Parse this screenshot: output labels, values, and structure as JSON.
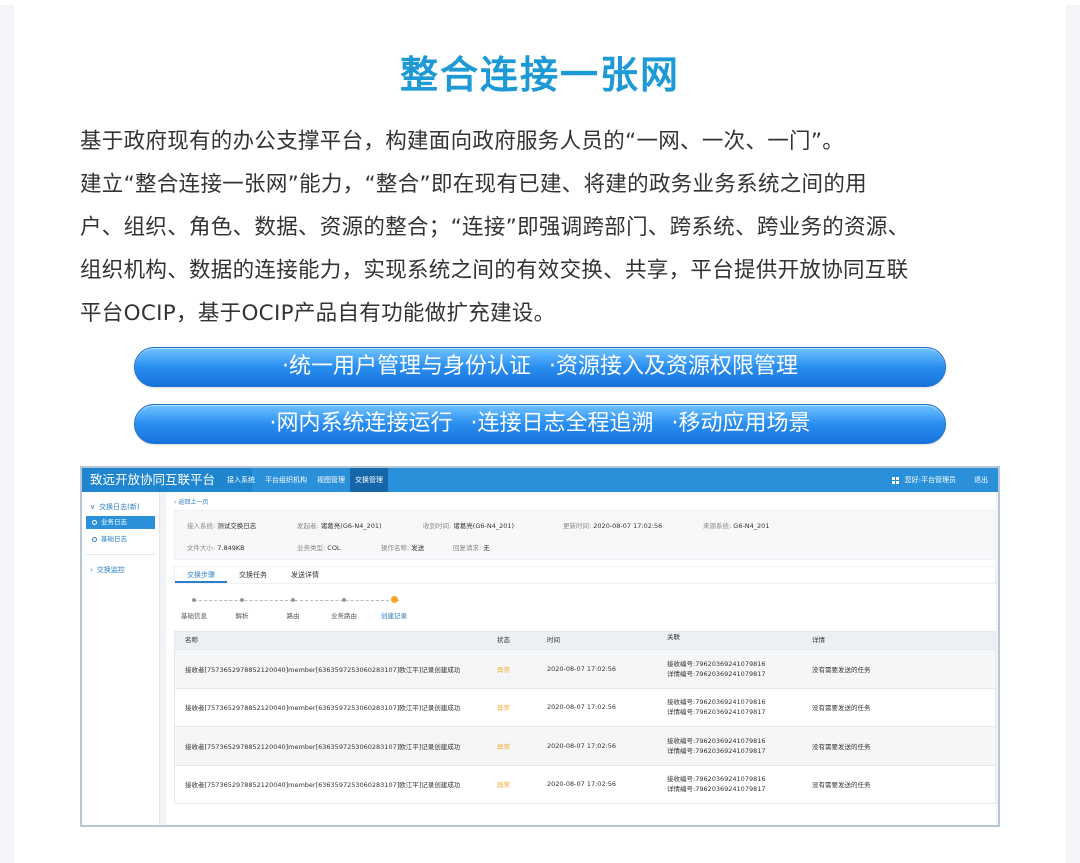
{
  "page": {
    "title": "整合连接一张网",
    "intro_lines": [
      "基于政府现有的办公支撑平台，构建面向政府服务人员的“一网、一次、一门”。",
      "建立“整合连接一张网”能力，“整合”即在现有已建、将建的政务业务系统之间的用",
      "户、组织、角色、数据、资源的整合；“连接”即强调跨部门、跨系统、跨业务的资源、",
      "组织机构、数据的连接能力，实现系统之间的有效交换、共享，平台提供开放协同互联",
      "平台OCIP，基于OCIP产品自有功能做扩充建设。"
    ],
    "features_row1": [
      "·统一用户管理与身份认证",
      "·资源接入及资源权限管理"
    ],
    "features_row2": [
      "·网内系统连接运行",
      "·连接日志全程追溯",
      "·移动应用场景"
    ]
  },
  "app": {
    "brand": "致远开放协同互联平台",
    "nav": [
      "接入系统",
      "平台组织机构",
      "视图管理",
      "交换管理"
    ],
    "nav_active_index": 3,
    "user_greeting": "您好:平台管理员",
    "logout": "退出",
    "sidebar": {
      "group1": "交换日志(新)",
      "items": [
        "业务日志",
        "基础日志"
      ],
      "group2": "交换监控"
    },
    "back_link": "返回上一页",
    "info": {
      "row1": [
        {
          "k": "接入系统:",
          "v": "测试交换日志"
        },
        {
          "k": "发起者:",
          "v": "诸葛亮(G6-N4_201)"
        },
        {
          "k": "收到时间:",
          "v": "诸葛亮(G6-N4_201)"
        },
        {
          "k": "更新时间:",
          "v": "2020-08-07 17:02:56"
        },
        {
          "k": "来源系统:",
          "v": "G6-N4_201"
        }
      ],
      "row2": [
        {
          "k": "文件大小:",
          "v": "7.849KB"
        },
        {
          "k": "业务类型:",
          "v": "COL"
        },
        {
          "k": "操作名称:",
          "v": "发送"
        },
        {
          "k": "回复请求:",
          "v": "无"
        }
      ]
    },
    "tabs": [
      "交换步骤",
      "交换任务",
      "发送详情"
    ],
    "steps": [
      "基础信息",
      "解析",
      "路由",
      "业务路由",
      "创建记录"
    ],
    "table": {
      "headers": [
        "名称",
        "状态",
        "时间",
        "关联",
        "详情"
      ],
      "rows": [
        {
          "name": "接收者[7573652978852120040]member[6363597253060283107]欧江平]记录创建成功",
          "status": "异常",
          "time": "2020-08-07 17:02:56",
          "rel1": "接收编号:79620369241079816",
          "rel2": "详情编号:79620369241079817",
          "detail": "没有需要发送的任务"
        },
        {
          "name": "接收者[7573652978852120040]member[6363597253060283107]欧江平]记录创建成功",
          "status": "异常",
          "time": "2020-08-07 17:02:56",
          "rel1": "接收编号:79620369241079816",
          "rel2": "详情编号:79620369241079817",
          "detail": "没有需要发送的任务"
        },
        {
          "name": "接收者[7573652978852120040]member[6363597253060283107]欧江平]记录创建成功",
          "status": "异常",
          "time": "2020-08-07 17:02:56",
          "rel1": "接收编号:79620369241079816",
          "rel2": "详情编号:79620369241079817",
          "detail": "没有需要发送的任务"
        },
        {
          "name": "接收者[7573652978852120040]member[6363597253060283107]欧江平]记录创建成功",
          "status": "异常",
          "time": "2020-08-07 17:02:56",
          "rel1": "接收编号:79620369241079816",
          "rel2": "详情编号:79620369241079817",
          "detail": "没有需要发送的任务"
        }
      ]
    }
  },
  "colors": {
    "title": "#1d9ad6",
    "pill_top": "#6fc3ff",
    "pill_bottom": "#1773dc",
    "app_header": "#2a90da",
    "warn": "#f5a623"
  }
}
